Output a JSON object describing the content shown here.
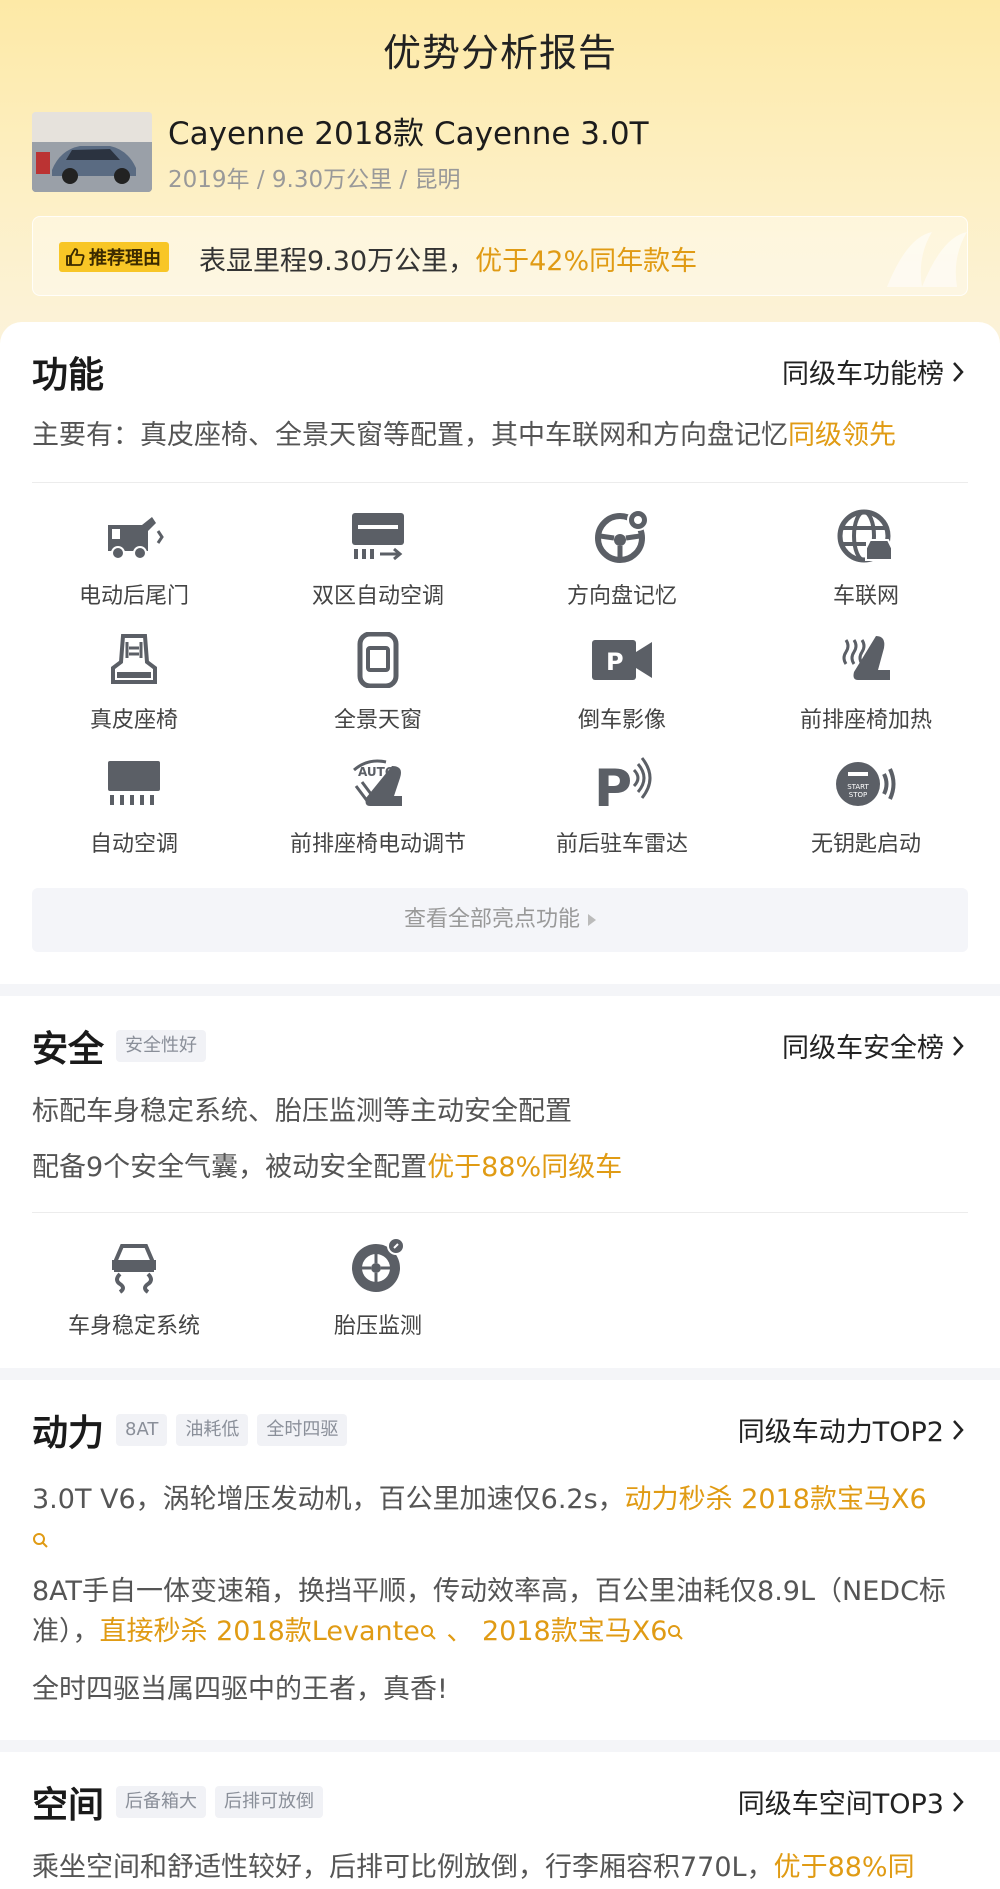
{
  "page_title": "优势分析报告",
  "car": {
    "title": "Cayenne 2018款 Cayenne 3.0T",
    "subtitle": "2019年 / 9.30万公里 / 昆明"
  },
  "reason": {
    "tag": "推荐理由",
    "text": "表显里程9.30万公里，",
    "highlight": "优于42%同年款车"
  },
  "function_section": {
    "title": "功能",
    "link": "同级车功能榜",
    "summary": "主要有：真皮座椅、全景天窗等配置，其中车联网和方向盘记忆",
    "summary_highlight": "同级领先",
    "features": [
      {
        "label": "电动后尾门",
        "icon": "power-tailgate-icon"
      },
      {
        "label": "双区自动空调",
        "icon": "dual-zone-ac-icon"
      },
      {
        "label": "方向盘记忆",
        "icon": "steering-memory-icon"
      },
      {
        "label": "车联网",
        "icon": "connected-car-icon"
      },
      {
        "label": "真皮座椅",
        "icon": "leather-seat-icon"
      },
      {
        "label": "全景天窗",
        "icon": "panoramic-sunroof-icon"
      },
      {
        "label": "倒车影像",
        "icon": "reverse-camera-icon"
      },
      {
        "label": "前排座椅加热",
        "icon": "seat-heating-icon"
      },
      {
        "label": "自动空调",
        "icon": "auto-ac-icon"
      },
      {
        "label": "前排座椅电动调节",
        "icon": "power-seat-icon"
      },
      {
        "label": "前后驻车雷达",
        "icon": "parking-radar-icon"
      },
      {
        "label": "无钥匙启动",
        "icon": "keyless-start-icon"
      }
    ],
    "view_all": "查看全部亮点功能",
    "auto_badge": "AUTO",
    "start_badge_1": "START",
    "start_badge_2": "STOP"
  },
  "safety_section": {
    "title": "安全",
    "tag": "安全性好",
    "link": "同级车安全榜",
    "line1": "标配车身稳定系统、胎压监测等主动安全配置",
    "line2": "配备9个安全气囊，被动安全配置",
    "line2_highlight": "优于88%同级车",
    "features": [
      {
        "label": "车身稳定系统",
        "icon": "stability-control-icon"
      },
      {
        "label": "胎压监测",
        "icon": "tire-pressure-icon"
      }
    ]
  },
  "power_section": {
    "title": "动力",
    "tags": [
      "8AT",
      "油耗低",
      "全时四驱"
    ],
    "link": "同级车动力TOP2",
    "para1": "3.0T V6，涡轮增压发动机，百公里加速仅6.2s，",
    "para1_highlight": "动力秒杀 2018款宝马X6",
    "para2": "8AT手自一体变速箱，换挡平顺，传动效率高，百公里油耗仅8.9L（NEDC标准），",
    "para2_highlight_a": "直接秒杀 2018款Levante",
    "para2_sep": " 、 ",
    "para2_highlight_b": "2018款宝马X6",
    "para3": "全时四驱当属四驱中的王者，真香!"
  },
  "space_section": {
    "title": "空间",
    "tags": [
      "后备箱大",
      "后排可放倒"
    ],
    "link": "同级车空间TOP3",
    "para": "乘坐空间和舒适性较好，后排可比例放倒，行李厢容积770L，",
    "para_highlight": "优于88%同"
  },
  "colors": {
    "accent": "#e09b14",
    "tag_yellow": "#f8c626",
    "icon_gray": "#5b5f66"
  }
}
